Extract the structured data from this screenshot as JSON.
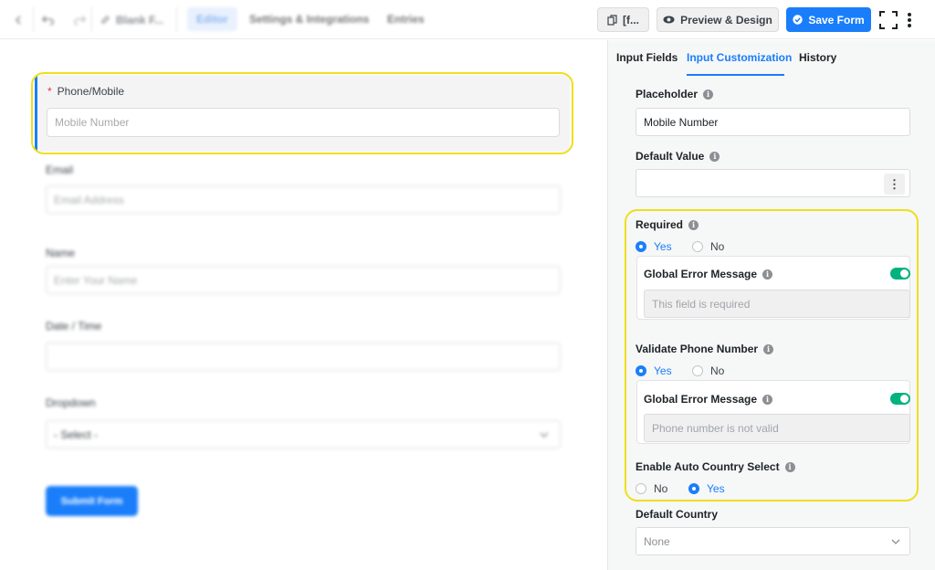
{
  "topbar": {
    "form_title": "Blank F...",
    "tabs": [
      "Editor",
      "Settings & Integrations",
      "Entries"
    ],
    "shortcode_label": "[f...",
    "preview_label": "Preview & Design",
    "save_label": "Save Form"
  },
  "canvas": {
    "active_field": {
      "label": "Phone/Mobile",
      "required_mark": "*",
      "placeholder": "Mobile Number"
    },
    "fields": [
      {
        "label": "Email",
        "placeholder": "Email Address"
      },
      {
        "label": "Name",
        "placeholder": "Enter Your Name"
      },
      {
        "label": "Date / Time",
        "placeholder": ""
      },
      {
        "label": "Dropdown",
        "placeholder": "- Select -"
      }
    ],
    "submit_label": "Submit Form"
  },
  "panel": {
    "tabs": [
      "Input Fields",
      "Input Customization",
      "History"
    ],
    "active_tab": "Input Customization",
    "placeholder": {
      "label": "Placeholder",
      "value": "Mobile Number"
    },
    "default_value": {
      "label": "Default Value",
      "value": ""
    },
    "required": {
      "label": "Required",
      "options": [
        "Yes",
        "No"
      ],
      "selected": "Yes",
      "global_error_label": "Global Error Message",
      "global_error_enabled": true,
      "error_placeholder": "This field is required"
    },
    "validate_phone": {
      "label": "Validate Phone Number",
      "options": [
        "Yes",
        "No"
      ],
      "selected": "Yes",
      "global_error_label": "Global Error Message",
      "global_error_enabled": true,
      "error_placeholder": "Phone number is not valid"
    },
    "auto_country": {
      "label": "Enable Auto Country Select",
      "options": [
        "No",
        "Yes"
      ],
      "selected": "Yes"
    },
    "default_country": {
      "label": "Default Country",
      "value": "None"
    }
  },
  "colors": {
    "accent": "#1a7efb",
    "toggle_on": "#00b27f",
    "highlight": "#eedf1c"
  }
}
